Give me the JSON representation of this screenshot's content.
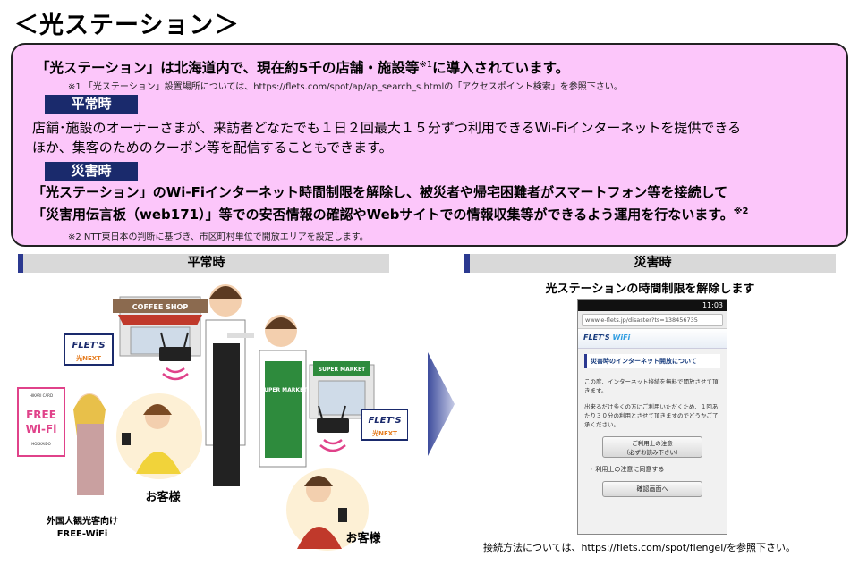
{
  "title": "＜光ステーション＞",
  "intro": {
    "text": "「光ステーション」は北海道内で、現在約5千の店舗・施設等",
    "sup": "※1",
    "text_after": "に導入されています。"
  },
  "note1": "※1 「光ステーション」設置場所については、https://flets.com/spot/ap/ap_search_s.htmlの「アクセスポイント検索」を参照下さい。",
  "normal": {
    "header": "平常時",
    "line1": "店舗･施設のオーナーさまが、来訪者どなたでも１日２回最大１５分ずつ利用できるWi-Fiインターネットを提供できる",
    "line2": "ほか、集客のためのクーポン等を配信することもできます。"
  },
  "disaster": {
    "header": "災害時",
    "line1": "「光ステーション」のWi-Fiインターネット時間制限を解除し、被災者や帰宅困難者がスマートフォン等を接続して",
    "line2": "「災害用伝言板（web171）」等での安否情報の確認やWebサイトでの情報収集等ができるよう運用を行ないます。",
    "sup": "※2"
  },
  "note2": "※2 NTT東日本の判断に基づき、市区町村単位で開放エリアを設定します。",
  "left_panel": {
    "header": "平常時",
    "coffee_shop": "COFFEE SHOP",
    "supermarket": "SUPER MARKET",
    "apron_text": "SUPER MARKET",
    "flets_logo": "FLET'S",
    "flets_sub": "光NEXT",
    "free_wifi_card_top": "HIKARI CARD",
    "free_wifi_card": "FREE Wi-Fi",
    "free_wifi_card_bottom": "HOKKAIDO",
    "customer_label_1": "お客様",
    "customer_label_2": "お客様",
    "tourist_label_1": "外国人観光客向け",
    "tourist_label_2": "FREE-WiFi"
  },
  "right_panel": {
    "header": "災害時",
    "release_title": "光ステーションの時間制限を解除します",
    "phone": {
      "time": "11:03",
      "url": "www.e-flets.jp/disaster?ts=138456735",
      "app_brand": "FLET'S",
      "app_brand_wifi": "WiFi",
      "section_title": "災害時のインターネット開放について",
      "text1": "この度、インターネット接続を無料で開放させて頂きます。",
      "text2": "出来るだけ多くの方にご利用いただくため、１回あたり３０分の利用とさせて頂きますのでどうかご了承ください。",
      "btn1_line1": "ご利用上の注意",
      "btn1_line2": "（必ずお読み下さい）",
      "agree": "利用上の注意に同意する",
      "btn2": "確認画面へ"
    },
    "connect_note": "接続方法については、https://flets.com/spot/flengel/を参照下さい。"
  },
  "colors": {
    "info_bg": "#fcc6fa",
    "header_navy": "#1a2a6c",
    "panel_grey": "#d9d9d9",
    "accent_blue": "#2b3990"
  }
}
